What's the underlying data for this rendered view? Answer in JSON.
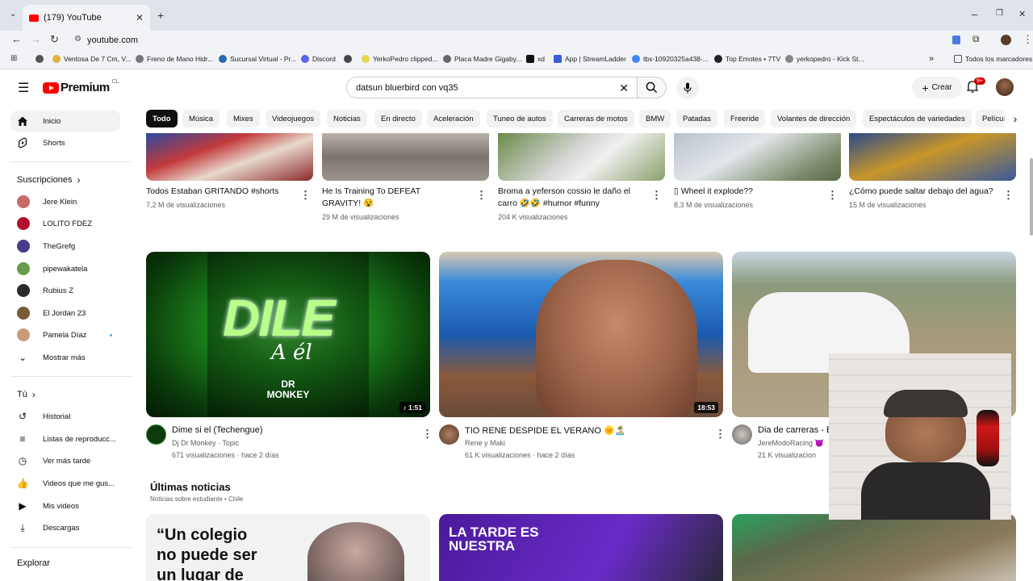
{
  "browser": {
    "tab_title": "(179) YouTube",
    "url": "youtube.com",
    "bookmarks": [
      {
        "label": "Ventosa De 7 Cm, V...",
        "color": "#e0b23a"
      },
      {
        "label": "Freno de Mano Hidr...",
        "color": "#777"
      },
      {
        "label": "Sucursal Virtual - Pr...",
        "color": "#2b6cb0"
      },
      {
        "label": "Discord",
        "color": "#5865f2"
      },
      {
        "label": "",
        "color": "#444"
      },
      {
        "label": "YerkoPedro clipped...",
        "color": "#e5d84a"
      },
      {
        "label": "Placa Madre Gigaby...",
        "color": "#666"
      },
      {
        "label": "xd",
        "color": "#111"
      },
      {
        "label": "App | StreamLadder",
        "color": "#3b5bdb"
      },
      {
        "label": "tbx-10920325a438-...",
        "color": "#4285f4"
      },
      {
        "label": "Top Emotes • 7TV",
        "color": "#222"
      },
      {
        "label": "yerkopedro - Kick St...",
        "color": "#888"
      }
    ],
    "all_bookmarks": "Todos los marcadores"
  },
  "header": {
    "logo_text": "Premium",
    "country": "CL",
    "search_value": "datsun bluerbird con vq35",
    "create_label": "Crear",
    "notif_badge": "9+"
  },
  "sidebar": {
    "main": [
      {
        "label": "Inicio",
        "icon": "home-icon"
      },
      {
        "label": "Shorts",
        "icon": "shorts-icon"
      }
    ],
    "subs_heading": "Suscripciones",
    "subscriptions": [
      {
        "label": "Jere Klein",
        "color": "#c96a6a"
      },
      {
        "label": "LOLITO FDEZ",
        "color": "#b0102a"
      },
      {
        "label": "TheGrefg",
        "color": "#4a3a8a"
      },
      {
        "label": "pipewakatela",
        "color": "#6a9a4a"
      },
      {
        "label": "Rubius Z",
        "color": "#2a2a2a"
      },
      {
        "label": "El Jordan 23",
        "color": "#7a5a3a"
      },
      {
        "label": "Pamela Díaz",
        "color": "#c99a7a"
      }
    ],
    "show_more": "Mostrar más",
    "you_heading": "Tú",
    "you_items": [
      {
        "label": "Historial",
        "icon": "history-icon"
      },
      {
        "label": "Listas de reproducc...",
        "icon": "playlist-icon"
      },
      {
        "label": "Ver más tarde",
        "icon": "clock-icon"
      },
      {
        "label": "Videos que me gus...",
        "icon": "like-icon"
      },
      {
        "label": "Mis videos",
        "icon": "video-icon"
      },
      {
        "label": "Descargas",
        "icon": "download-icon"
      }
    ],
    "explore_heading": "Explorar"
  },
  "chips": [
    "Todo",
    "Música",
    "Mixes",
    "Videojuegos",
    "Noticias",
    "En directo",
    "Aceleración",
    "Tuneo de autos",
    "Carreras de motos",
    "BMW",
    "Patadas",
    "Freeride",
    "Volantes de dirección",
    "Espectáculos de variedades",
    "Películ"
  ],
  "shorts": [
    {
      "title": "Todos Estaban GRITANDO #shorts",
      "views": "7,2 M de visualizaciones"
    },
    {
      "title": "He Is Training To DEFEAT GRAVITY! 😵",
      "views": "29 M de visualizaciones"
    },
    {
      "title": "Broma a yeferson  cossio le daño el carro 🤣🤣 #humor #funny",
      "views": "204 K visualizaciones"
    },
    {
      "title": "▯ Wheel it explode??",
      "views": "8,3 M de visualizaciones"
    },
    {
      "title": "¿Cómo puede saltar debajo del agua?",
      "views": "15 M de visualizaciones"
    }
  ],
  "videos": [
    {
      "title": "Dime si el (Techengue)",
      "channel": "Dj Dr Monkey · Topic",
      "meta": "671 visualizaciones · hace 2 días",
      "duration": "♪ 1:51",
      "thumb_text": "DILE",
      "thumb_sub": "A él",
      "thumb_brand": "DR MONKEY"
    },
    {
      "title": "TIO RENE DESPIDE EL VERANO 🌞🏝️",
      "channel": "Rene y Maki",
      "meta": "61 K visualizaciones · hace 2 días",
      "duration": "18:53"
    },
    {
      "title": "Dia de carreras - B",
      "channel": "JereModoRacing 😈",
      "meta": "21 K visualizacion"
    }
  ],
  "news": {
    "title": "Últimas noticias",
    "subtitle": "Noticias sobre estudiante • Chile",
    "items": [
      {
        "text": "“Un colegio no puede ser un lugar de"
      },
      {
        "text": "LA TARDE ES NUESTRA"
      },
      {
        "text": ""
      }
    ]
  }
}
